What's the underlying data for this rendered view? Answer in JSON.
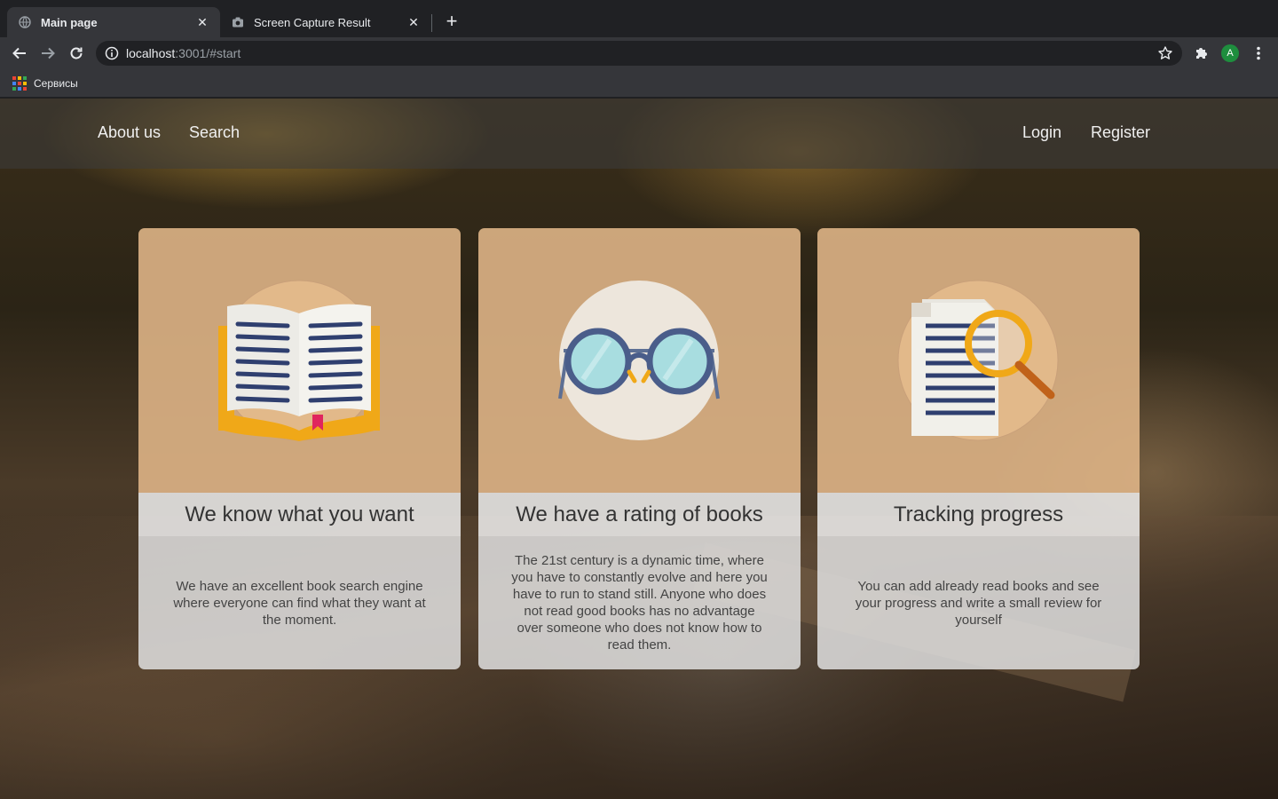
{
  "browser": {
    "tabs": [
      {
        "title": "Main page",
        "active": true,
        "icon": "globe-icon"
      },
      {
        "title": "Screen Capture Result",
        "active": false,
        "icon": "camera-icon"
      }
    ],
    "close_glyph": "✕",
    "new_tab_glyph": "+",
    "url_host": "localhost",
    "url_rest": ":3001/#start",
    "avatar_letter": "A",
    "bookmarks": [
      {
        "label": "Сервисы",
        "icon": "apps-grid-icon"
      }
    ]
  },
  "navbar": {
    "left": [
      "About us",
      "Search"
    ],
    "right": [
      "Login",
      "Register"
    ]
  },
  "cards": [
    {
      "icon": "open-book-icon",
      "heading": "We know what you want",
      "text": "We have an excellent book search engine where everyone can find what they want at the moment."
    },
    {
      "icon": "glasses-icon",
      "heading": "We have a rating of books",
      "text": "The 21st century is a dynamic time, where you have to constantly evolve and here you have to run to stand still. Anyone who does not read good books has no advantage over someone who does not know how to read them."
    },
    {
      "icon": "document-magnifier-icon",
      "heading": "Tracking progress",
      "text": "You can add already read books and see your progress and write a small review for yourself"
    }
  ],
  "colors": {
    "card_top": "#deb486",
    "browser_dark": "#202124",
    "browser_toolbar": "#35363a",
    "avatar": "#1e8e3e"
  }
}
